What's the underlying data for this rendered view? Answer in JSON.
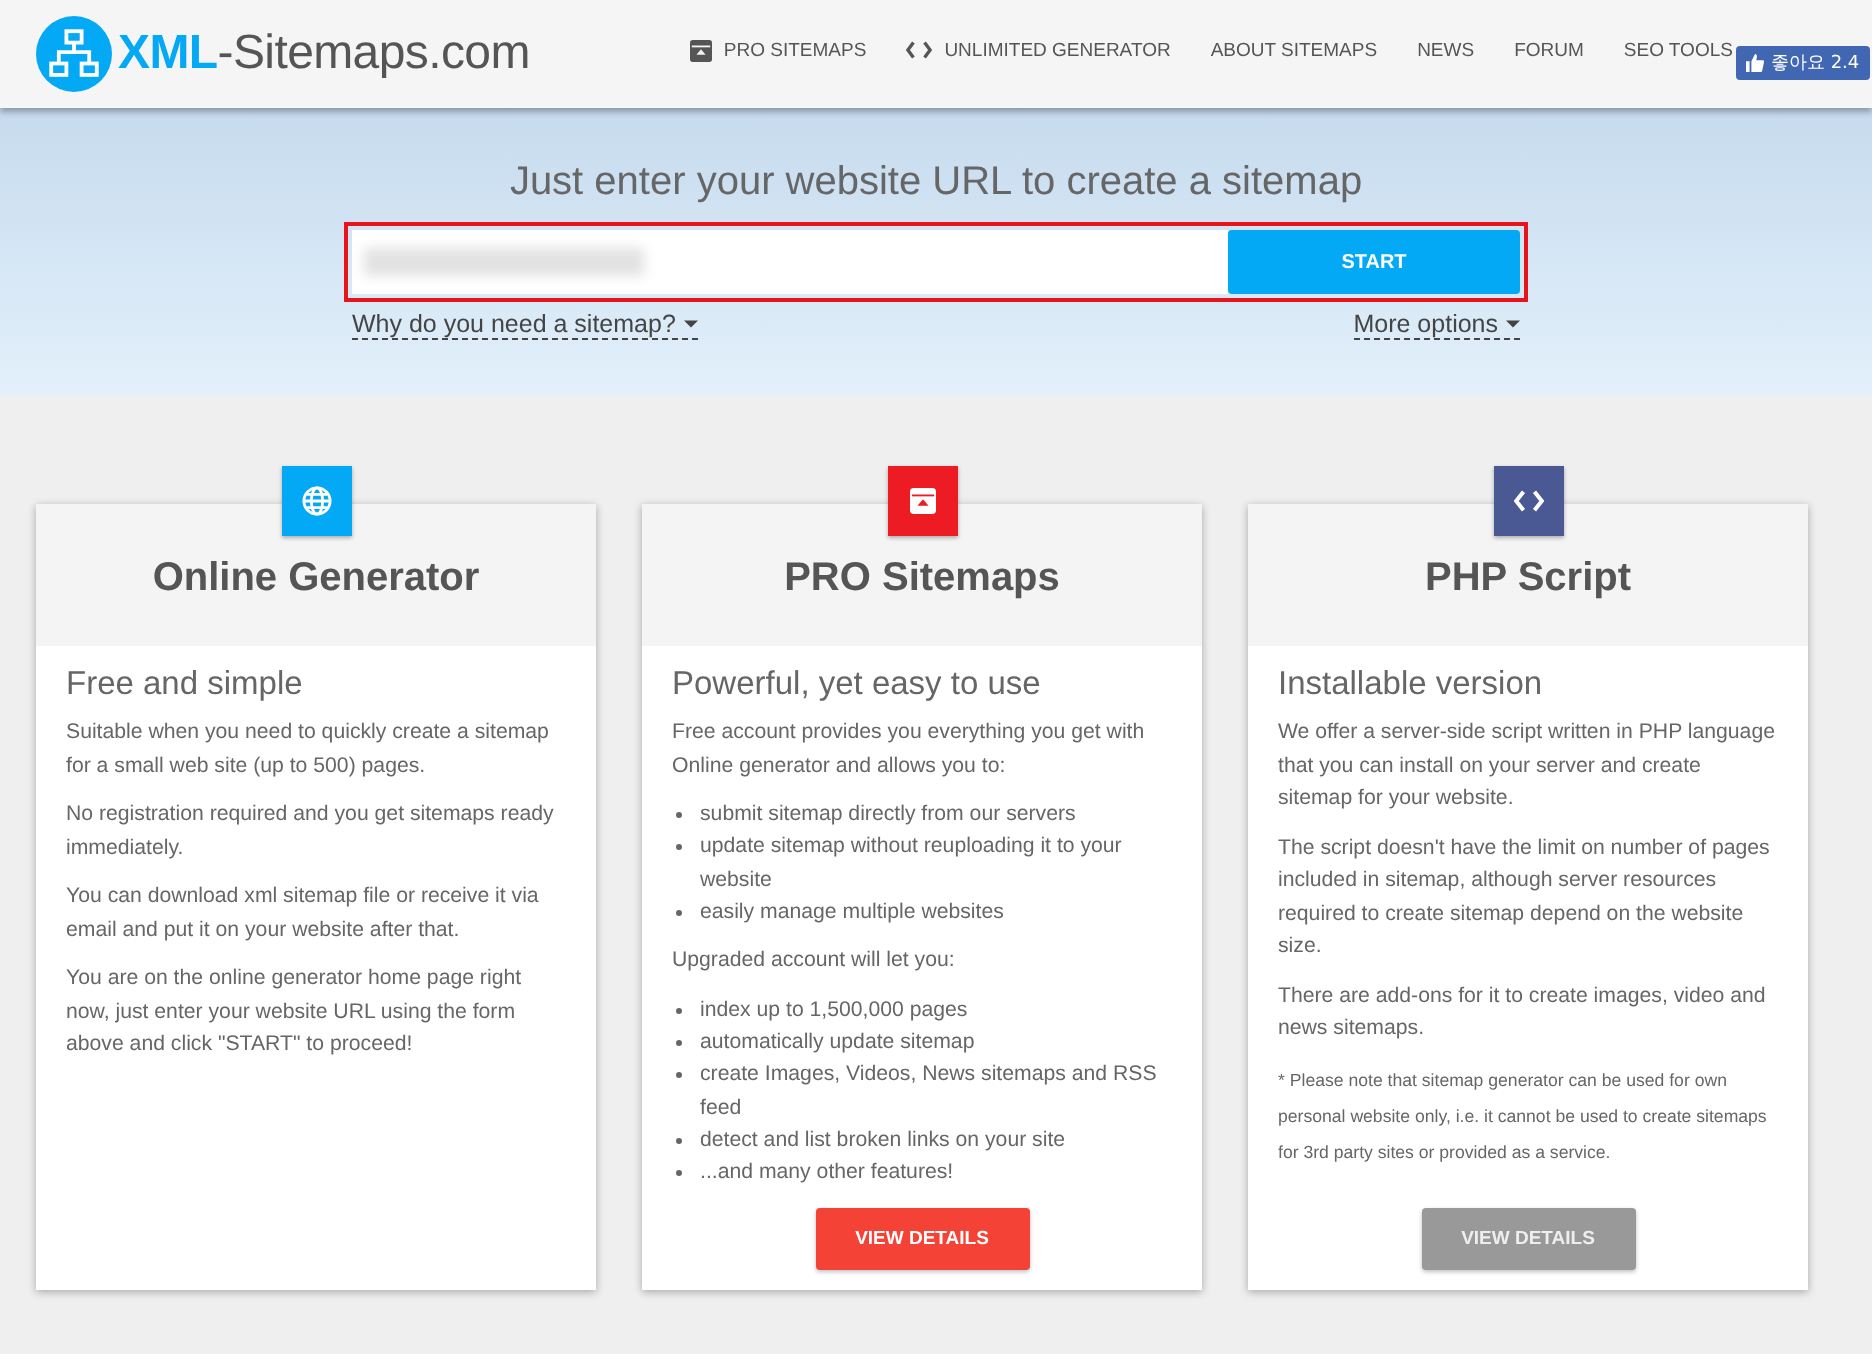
{
  "header": {
    "logo": {
      "brand": "XML",
      "suffix": "-Sitemaps.com"
    },
    "nav": [
      {
        "label": "PRO SITEMAPS",
        "kind": "box"
      },
      {
        "label": "UNLIMITED GENERATOR",
        "kind": "code"
      },
      {
        "label": "ABOUT SITEMAPS",
        "kind": "text"
      },
      {
        "label": "NEWS",
        "kind": "text"
      },
      {
        "label": "FORUM",
        "kind": "text"
      },
      {
        "label": "SEO TOOLS",
        "kind": "text"
      }
    ],
    "like_button": {
      "label": "좋아요 2.4"
    }
  },
  "hero": {
    "title": "Just enter your website URL to create a sitemap",
    "url_field": {
      "redacted": true
    },
    "start_button": "START",
    "highlighted": true,
    "links": [
      "Why do you need a sitemap?",
      "More options"
    ]
  },
  "cards": [
    {
      "kind": "globe",
      "color": "#03a9f4",
      "title": "Online Generator",
      "subtitle": "Free and simple",
      "blocks": [
        {
          "kind": "p",
          "text": "Suitable when you need to quickly create a sitemap for a small web site (up to 500) pages."
        },
        {
          "kind": "p",
          "text": "No registration required and you get sitemaps ready immediately."
        },
        {
          "kind": "p",
          "text": "You can download xml sitemap file or receive it via email and put it on your website after that."
        },
        {
          "kind": "p",
          "text": "You are on the online generator home page right now, just enter your website URL using the form above and click \"START\" to proceed!"
        }
      ]
    },
    {
      "kind": "box",
      "color": "#ed1c24",
      "title": "PRO Sitemaps",
      "subtitle": "Powerful, yet easy to use",
      "blocks": [
        {
          "kind": "p",
          "text": "Free account provides you everything you get with Online generator and allows you to:"
        },
        {
          "kind": "list",
          "items": [
            "submit sitemap directly from our servers",
            "update sitemap without reuploading it to your website",
            "easily manage multiple websites"
          ]
        },
        {
          "kind": "p",
          "text": "Upgraded account will let you:"
        },
        {
          "kind": "list",
          "items": [
            "index up to 1,500,000 pages",
            "automatically update sitemap",
            "create Images, Videos, News sitemaps and RSS feed",
            "detect and list broken links on your site",
            "...and many other features!"
          ]
        }
      ],
      "button": {
        "label": "VIEW DETAILS",
        "kind": "primary"
      }
    },
    {
      "kind": "code",
      "color": "#4a5894",
      "title": "PHP Script",
      "subtitle": "Installable version",
      "blocks": [
        {
          "kind": "p",
          "text": "We offer a server-side script written in PHP language that you can install on your server and create sitemap for your website."
        },
        {
          "kind": "p",
          "text": "The script doesn't have the limit on number of pages included in sitemap, although server resources required to create sitemap depend on the website size."
        },
        {
          "kind": "p",
          "text": "There are add-ons for it to create images, video and news sitemaps."
        },
        {
          "kind": "note",
          "text": "* Please note that sitemap generator can be used for own personal website only, i.e. it cannot be used to create sitemaps for 3rd party sites or provided as a service."
        }
      ],
      "button": {
        "label": "VIEW DETAILS",
        "kind": "secondary"
      }
    }
  ]
}
